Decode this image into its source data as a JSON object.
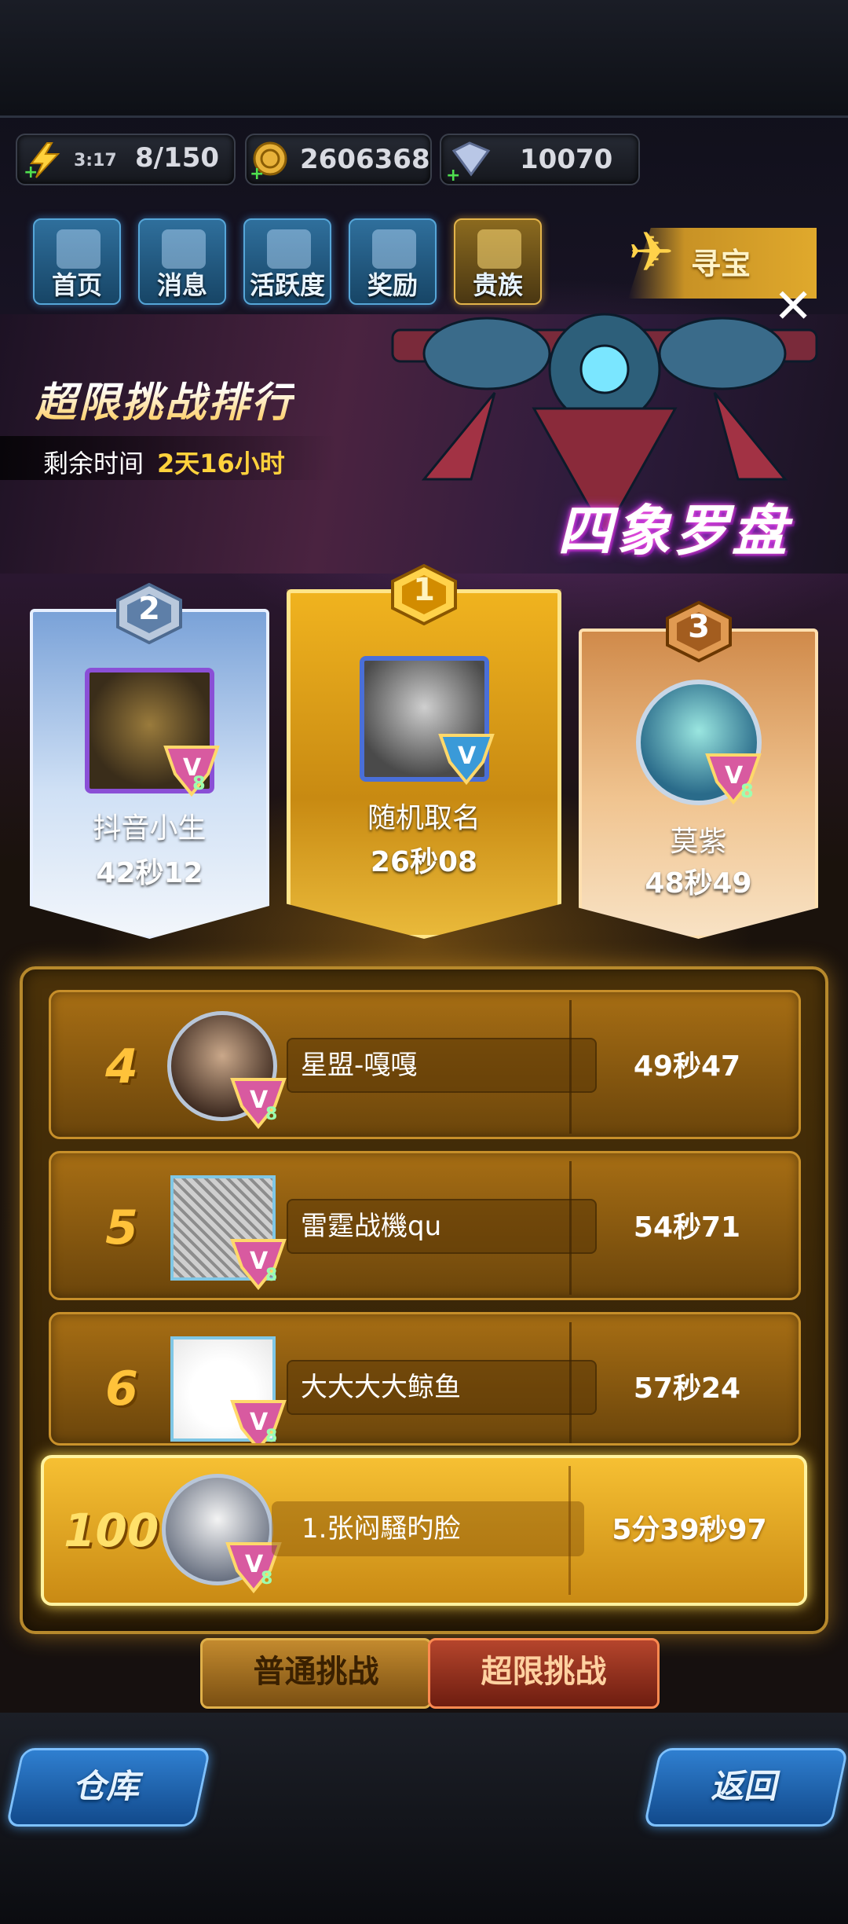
{
  "resources": {
    "energy_timer": "3:17",
    "energy": "8/150",
    "gold": "2606368",
    "gems": "10070"
  },
  "nav": [
    {
      "label": "首页",
      "icon": "home-icon"
    },
    {
      "label": "消息",
      "icon": "mail-icon"
    },
    {
      "label": "活跃度",
      "icon": "smile-icon"
    },
    {
      "label": "奖励",
      "icon": "gift-icon"
    },
    {
      "label": "贵族",
      "icon": "vip-icon"
    }
  ],
  "treasure_label": "寻宝",
  "banner": {
    "title": "超限挑战排行",
    "time_label": "剩余时间",
    "time_value": "2天16小时",
    "ship_name": "四象罗盘"
  },
  "podium": [
    {
      "rank": "2",
      "name": "抖音小生",
      "time": "42秒12",
      "vip": "8"
    },
    {
      "rank": "1",
      "name": "随机取名",
      "time": "26秒08",
      "vip": ""
    },
    {
      "rank": "3",
      "name": "莫紫",
      "time": "48秒49",
      "vip": "8"
    }
  ],
  "rows": [
    {
      "rank": "4",
      "name": "星盟-嘎嘎",
      "time": "49秒47",
      "vip": "8"
    },
    {
      "rank": "5",
      "name": "雷霆战機qu",
      "time": "54秒71",
      "vip": "8"
    },
    {
      "rank": "6",
      "name": "大大大大鲸鱼",
      "time": "57秒24",
      "vip": "8"
    }
  ],
  "me": {
    "rank": "100+",
    "name": "1.张闷騷旳脸",
    "time": "5分39秒97",
    "vip": "8"
  },
  "tabs": {
    "normal": "普通挑战",
    "extreme": "超限挑战"
  },
  "bottom": {
    "warehouse": "仓库",
    "back": "返回"
  }
}
